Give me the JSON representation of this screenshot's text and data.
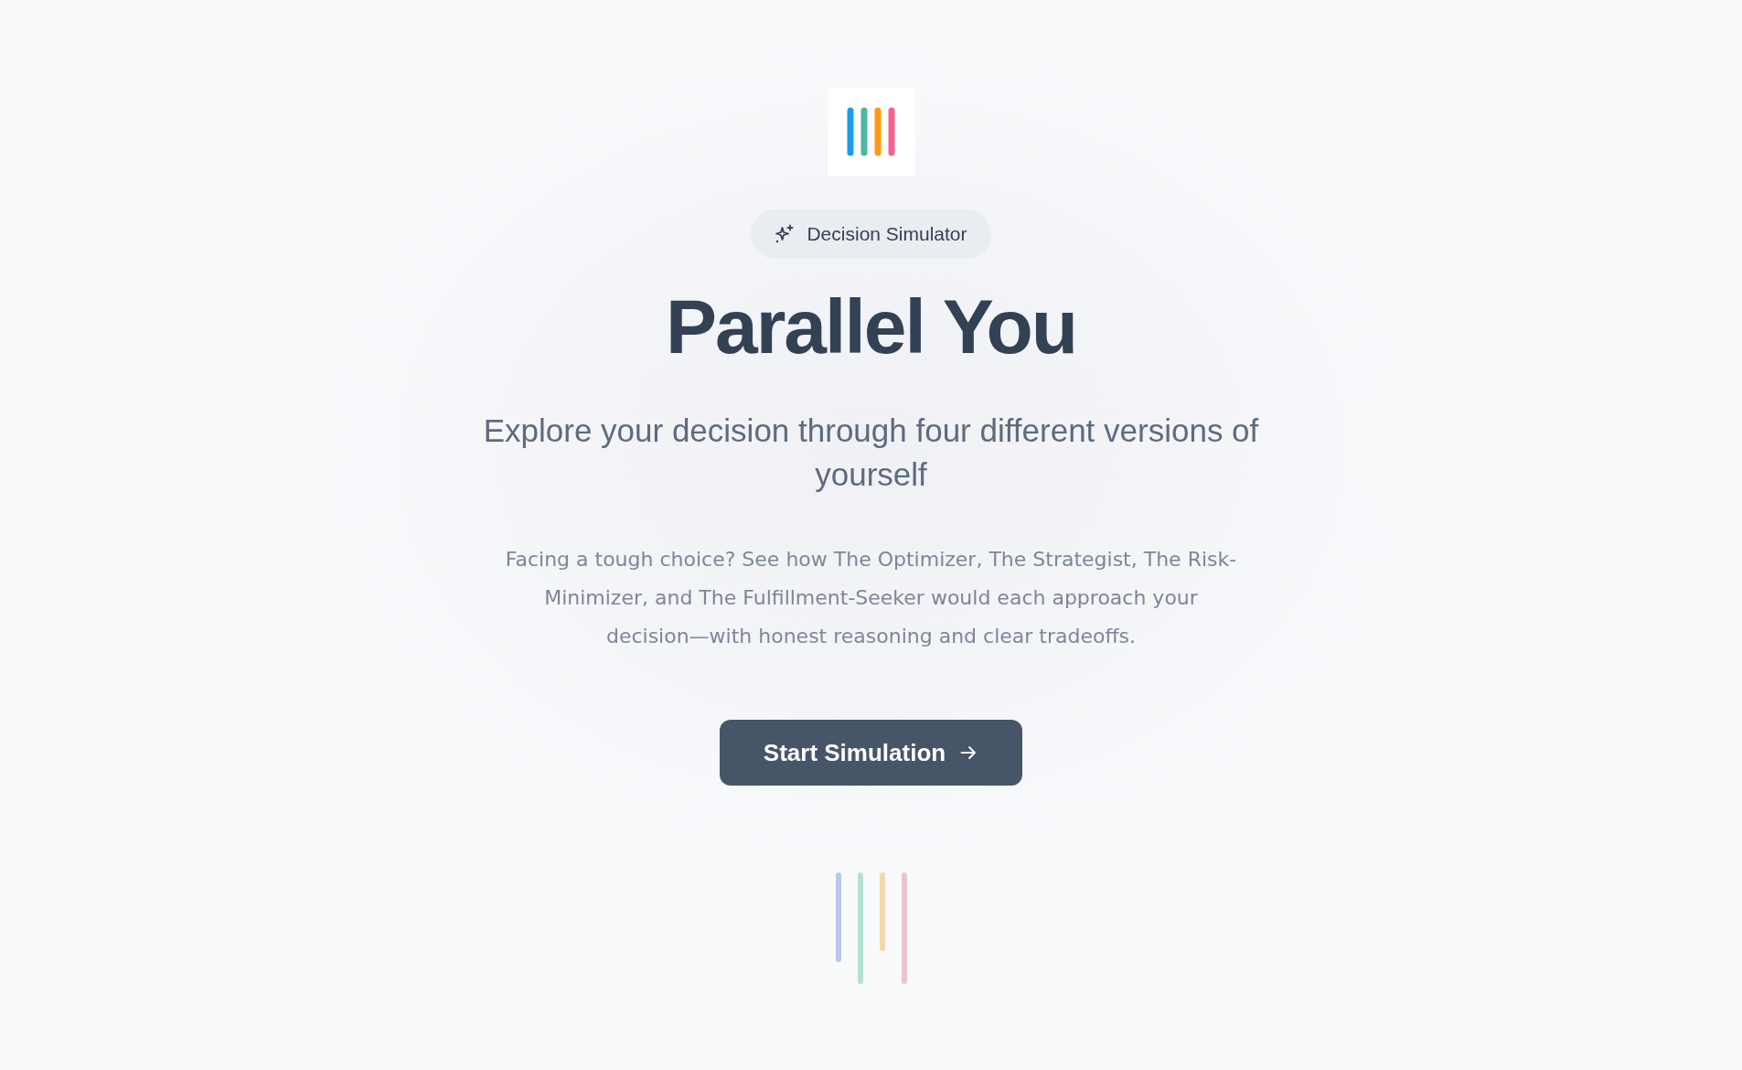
{
  "badge": {
    "label": "Decision Simulator"
  },
  "title": "Parallel You",
  "subtitle": "Explore your decision through four different versions of yourself",
  "description": "Facing a tough choice? See how The Optimizer, The Strategist, The Risk-Minimizer, and The Fulfillment-Seeker would each approach your decision—with honest reasoning and clear tradeoffs.",
  "cta_button": {
    "label": "Start Simulation"
  }
}
